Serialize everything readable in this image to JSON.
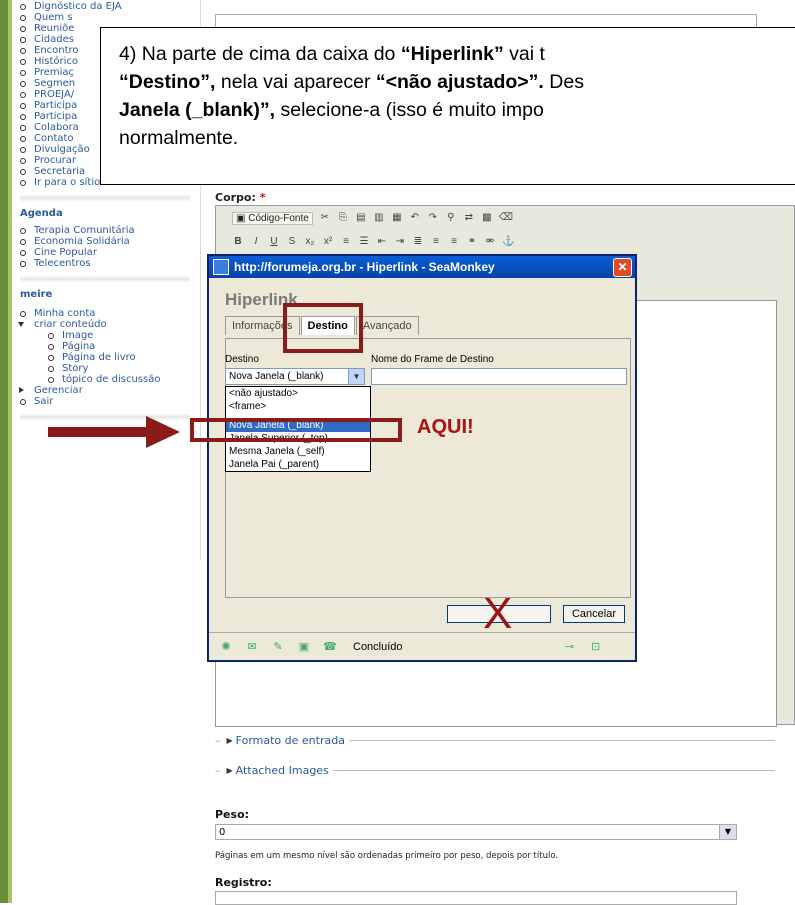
{
  "sidebar": {
    "items_top": [
      "Dignóstico da EJA",
      "Quem s",
      "Reuniõe",
      "Cidades",
      "Encontro",
      "Histórico",
      "Premiaç",
      "Segmen",
      "PROEJA/",
      "Participa",
      "Participa",
      "Colabora",
      "Contato",
      "Divulgação",
      "Procurar",
      "Secretaria",
      "Ir para o sítio BRASIL"
    ],
    "agenda_title": "Agenda",
    "agenda_items": [
      "Terapia Comunitária",
      "Economia Solidária",
      "Cine Popular",
      "Telecentros"
    ],
    "user_title": "meire",
    "user_items": [
      "Minha conta"
    ],
    "create_label": "criar conteúdo",
    "create_sub": [
      "Image",
      "Página",
      "Página de livro",
      "Story",
      "tópico de discussão"
    ],
    "manage": "Gerenciar",
    "logout": "Sair"
  },
  "note": {
    "line1_a": "4) Na parte de cima da caixa do ",
    "line1_b": "“Hiperlink”",
    "line1_c": " vai t",
    "line2_a": "“Destino”,",
    "line2_b": " nela vai aparecer ",
    "line2_c": "“<não ajustado>”.",
    "line2_d": " Des",
    "line3_a": "Janela (_blank)”,",
    "line3_b": " selecione-a (isso é muito impo",
    "line4": "normalmente."
  },
  "editor": {
    "body_label": "Corpo:",
    "required_mark": "*",
    "source_button": "Código-Fonte"
  },
  "dialog": {
    "title": "http://forumeja.org.br - Hiperlink - SeaMonkey",
    "heading": "Hiperlink",
    "tabs": [
      "Informações",
      "Destino",
      "Avançado"
    ],
    "destino_label": "Destino",
    "frame_label": "Nome do Frame de Destino",
    "selected": "Nova Janela (_blank)",
    "options": [
      "<não ajustado>",
      "<frame>",
      "Nova Janela (_blank)",
      "Janela Superior (_top)",
      "Mesma Janela (_self)",
      "Janela Pai (_parent)"
    ],
    "ok_label": "",
    "cancel_label": "Cancelar",
    "status": "Concluído"
  },
  "annotations": {
    "aqui": "AQUI!",
    "x_mark": "X"
  },
  "form": {
    "input_format": "Formato de entrada",
    "attached_images": "Attached Images",
    "weight_label": "Peso:",
    "weight_value": "0",
    "weight_help": "Páginas em um mesmo nível são ordenadas primeiro por peso, depois por título.",
    "registry_label": "Registro:"
  }
}
